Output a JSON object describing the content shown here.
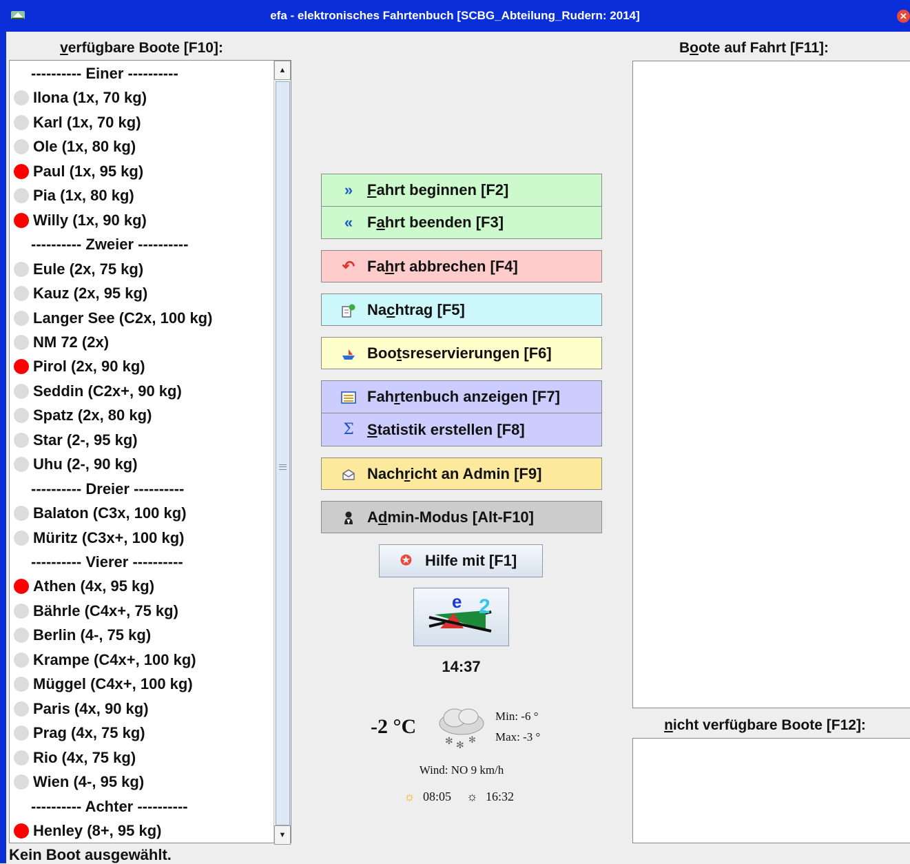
{
  "window": {
    "title": "efa - elektronisches Fahrtenbuch [SCBG_Abteilung_Rudern: 2014]"
  },
  "left_panel": {
    "heading_accel": "v",
    "heading_rest": "erfügbare Boote [F10]:",
    "boats": [
      {
        "label": "---------- Einer ----------",
        "header": true
      },
      {
        "label": "Ilona (1x, 70 kg)",
        "status": "gray"
      },
      {
        "label": "Karl (1x, 70 kg)",
        "status": "gray"
      },
      {
        "label": "Ole (1x, 80 kg)",
        "status": "gray"
      },
      {
        "label": "Paul (1x, 95 kg)",
        "status": "red"
      },
      {
        "label": "Pia (1x, 80 kg)",
        "status": "gray"
      },
      {
        "label": "Willy (1x, 90 kg)",
        "status": "red"
      },
      {
        "label": "---------- Zweier ----------",
        "header": true
      },
      {
        "label": "Eule (2x, 75 kg)",
        "status": "gray"
      },
      {
        "label": "Kauz (2x, 95 kg)",
        "status": "gray"
      },
      {
        "label": "Langer See (C2x, 100 kg)",
        "status": "gray"
      },
      {
        "label": "NM 72 (2x)",
        "status": "gray"
      },
      {
        "label": "Pirol (2x, 90 kg)",
        "status": "red"
      },
      {
        "label": "Seddin (C2x+, 90 kg)",
        "status": "gray"
      },
      {
        "label": "Spatz (2x, 80 kg)",
        "status": "gray"
      },
      {
        "label": "Star (2-, 95 kg)",
        "status": "gray"
      },
      {
        "label": "Uhu (2-, 90 kg)",
        "status": "gray"
      },
      {
        "label": "---------- Dreier ----------",
        "header": true
      },
      {
        "label": "Balaton (C3x, 100 kg)",
        "status": "gray"
      },
      {
        "label": "Müritz (C3x+, 100 kg)",
        "status": "gray"
      },
      {
        "label": "---------- Vierer ----------",
        "header": true
      },
      {
        "label": "Athen (4x, 95 kg)",
        "status": "red"
      },
      {
        "label": "Bährle (C4x+, 75 kg)",
        "status": "gray"
      },
      {
        "label": "Berlin (4-, 75 kg)",
        "status": "gray"
      },
      {
        "label": "Krampe (C4x+, 100 kg)",
        "status": "gray"
      },
      {
        "label": "Müggel (C4x+, 100 kg)",
        "status": "gray"
      },
      {
        "label": "Paris (4x, 90 kg)",
        "status": "gray"
      },
      {
        "label": "Prag (4x, 75 kg)",
        "status": "gray"
      },
      {
        "label": "Rio (4x, 75 kg)",
        "status": "gray"
      },
      {
        "label": "Wien (4-, 95 kg)",
        "status": "gray"
      },
      {
        "label": "---------- Achter ----------",
        "header": true
      },
      {
        "label": "Henley (8+, 95 kg)",
        "status": "red"
      }
    ]
  },
  "actions": {
    "start": {
      "pre": "",
      "accel": "F",
      "post": "ahrt beginnen [F2]",
      "icon": "double-chevron-right-icon"
    },
    "end": {
      "pre": "F",
      "accel": "a",
      "post": "hrt beenden [F3]",
      "icon": "double-chevron-left-icon"
    },
    "cancel": {
      "pre": "Fa",
      "accel": "h",
      "post": "rt abbrechen [F4]",
      "icon": "undo-arrow-icon"
    },
    "late_entry": {
      "pre": "Na",
      "accel": "c",
      "post": "htrag [F5]",
      "icon": "notepad-icon"
    },
    "reservations": {
      "pre": "Boo",
      "accel": "t",
      "post": "sreservierungen [F6]",
      "icon": "boat-icon"
    },
    "logbook": {
      "pre": "Fah",
      "accel": "r",
      "post": "tenbuch anzeigen [F7]",
      "icon": "list-icon"
    },
    "statistics": {
      "pre": "",
      "accel": "S",
      "post": "tatistik erstellen [F8]",
      "icon": "sigma-icon"
    },
    "message": {
      "pre": "Nach",
      "accel": "r",
      "post": "icht an Admin [F9]",
      "icon": "envelope-icon"
    },
    "admin": {
      "pre": "A",
      "accel": "d",
      "post": "min-Modus [Alt-F10]",
      "icon": "admin-user-icon"
    },
    "help": {
      "label": "Hilfe mit [F1]",
      "icon": "lifebuoy-icon"
    }
  },
  "logo": {
    "letters": "e",
    "number": "2"
  },
  "clock": "14:37",
  "weather": {
    "temperature": "-2 °C",
    "min": "Min: -6 °",
    "max": "Max: -3 °",
    "wind": "Wind: NO 9 km/h",
    "sunrise": "08:05",
    "sunset": "16:32"
  },
  "right_panel": {
    "boats_out_pre": "B",
    "boats_out_accel": "o",
    "boats_out_post": "ote auf Fahrt [F11]:",
    "unavailable_accel": "n",
    "unavailable_post": "icht verfügbare Boote [F12]:"
  },
  "status_bar": "Kein Boot ausgewählt.",
  "colors": {
    "title_bar": "#0a2fd8",
    "green": "#ccfacc",
    "red": "#ffcccc",
    "cyan": "#ccf8fb",
    "yellow": "#ffffcc",
    "lavender": "#ccccff",
    "gold": "#fde99b",
    "gray": "#cccccc",
    "busy_dot": "#ff0000"
  }
}
